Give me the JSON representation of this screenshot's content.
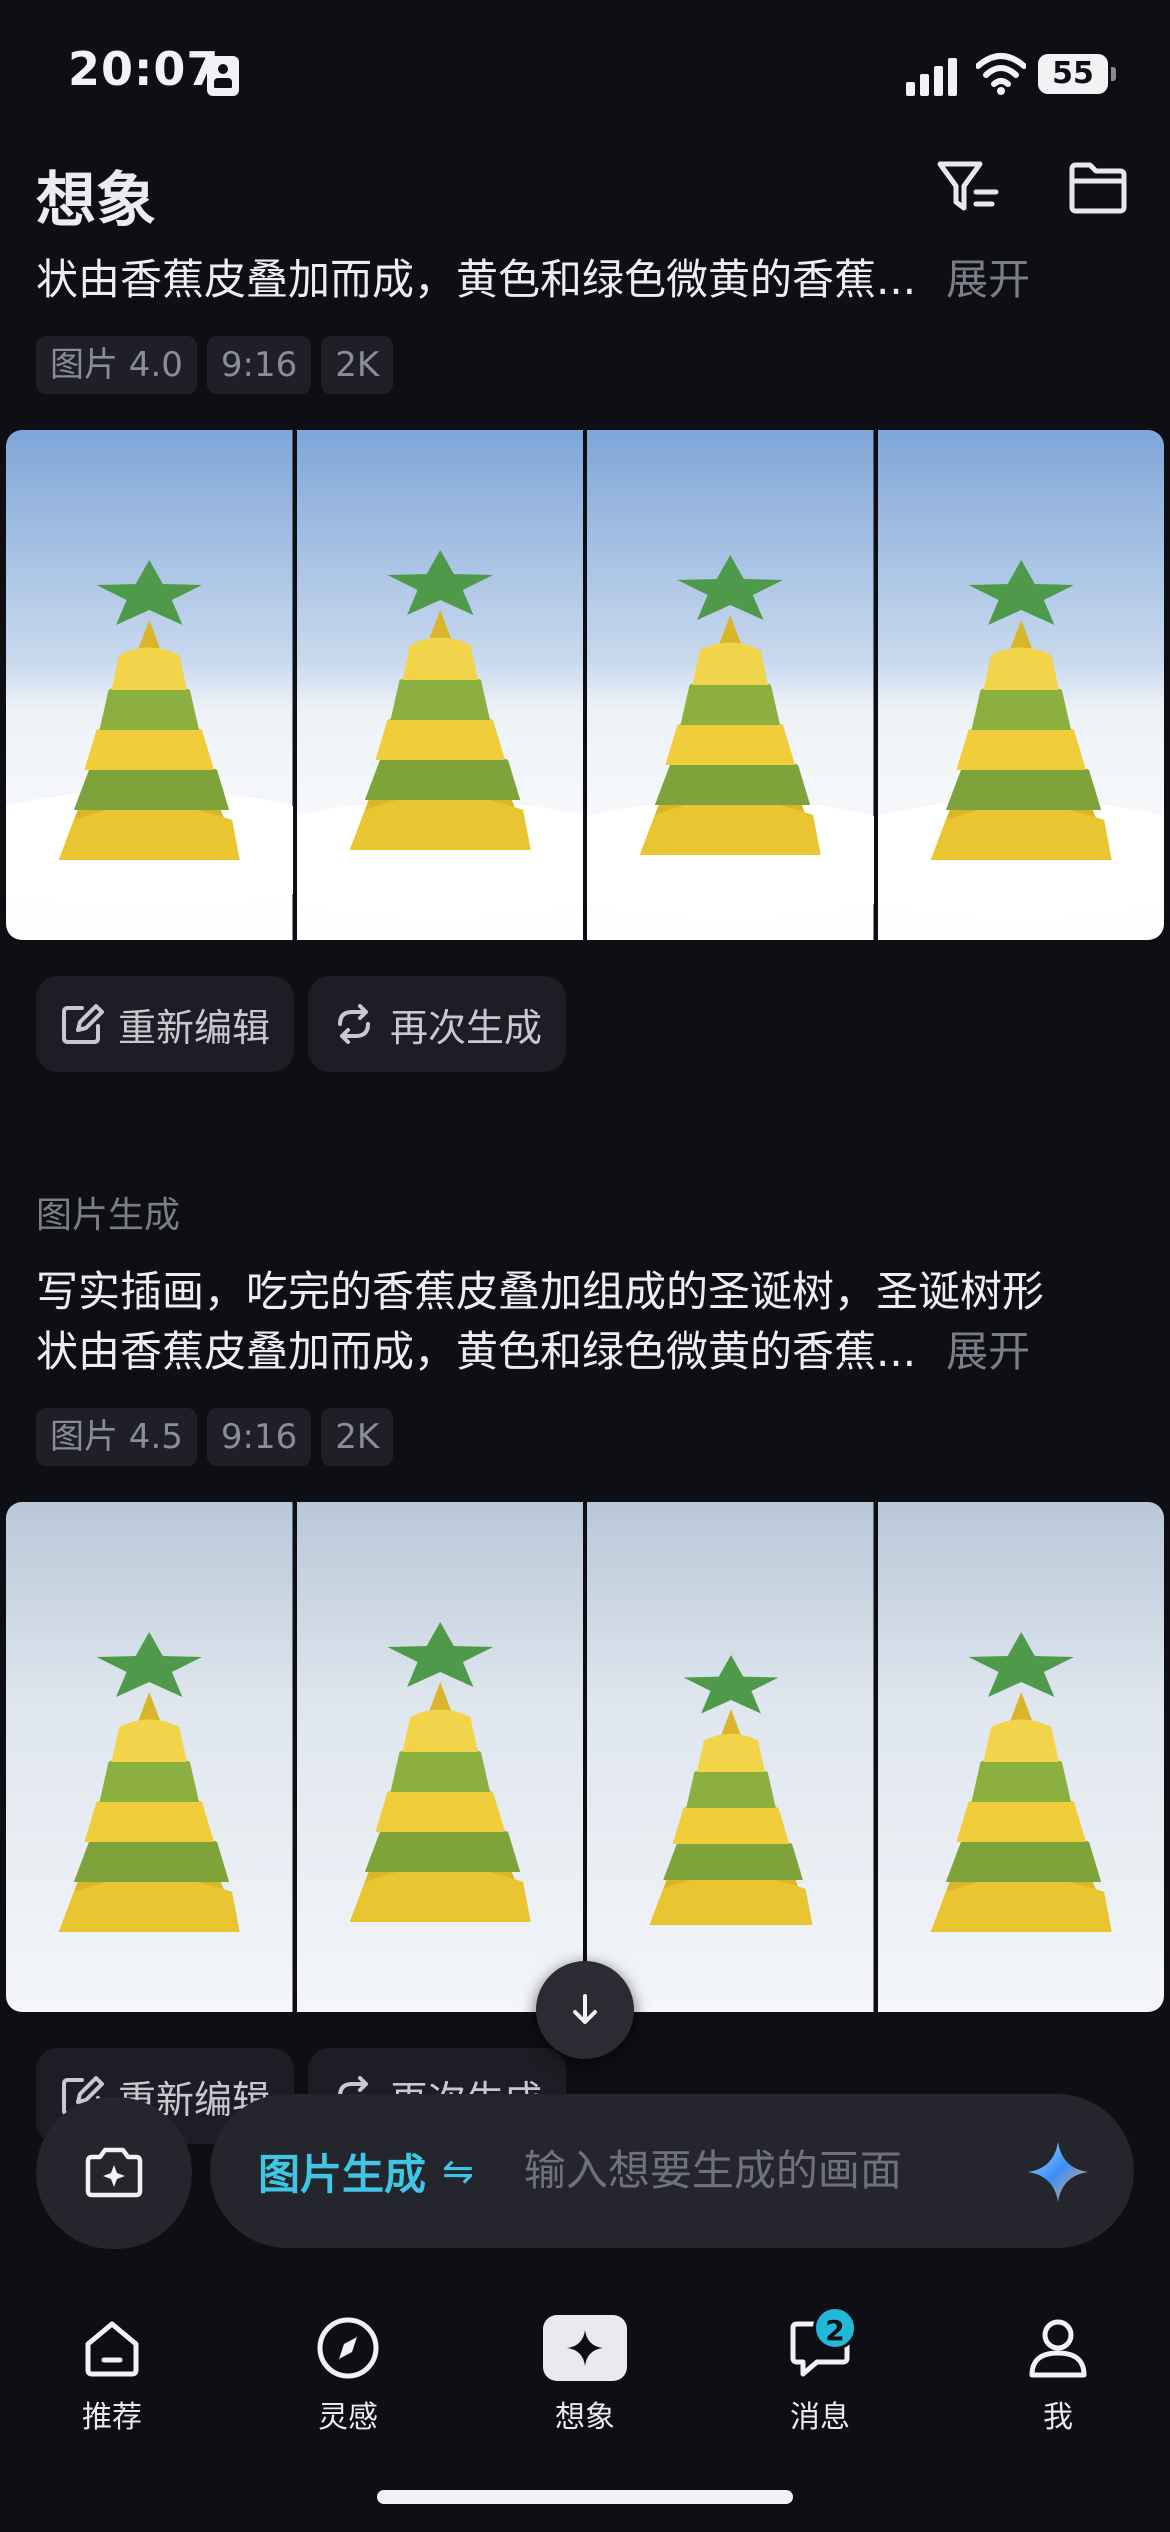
{
  "status_bar": {
    "time": "20:07",
    "battery": "55"
  },
  "header": {
    "title": "想象"
  },
  "block1": {
    "prompt_line2": "状由香蕉皮叠加而成，黄色和绿色微黄的香蕉...",
    "expand": "展开",
    "chips": [
      "图片 4.0",
      "9:16",
      "2K"
    ],
    "actions": {
      "re_edit": "重新编辑",
      "regenerate": "再次生成"
    }
  },
  "block2": {
    "label": "图片生成",
    "prompt_line1": "写实插画，吃完的香蕉皮叠加组成的圣诞树，圣诞树形",
    "prompt_line2": "状由香蕉皮叠加而成，黄色和绿色微黄的香蕉...",
    "expand": "展开",
    "chips": [
      "图片 4.5",
      "9:16",
      "2K"
    ],
    "actions": {
      "re_edit": "重新编辑",
      "regenerate": "再次生成"
    }
  },
  "composer": {
    "mode": "图片生成",
    "mode_swap": "⇋",
    "placeholder": "输入想要生成的画面"
  },
  "nav": {
    "items": [
      {
        "label": "推荐",
        "icon": "home-icon"
      },
      {
        "label": "灵感",
        "icon": "compass-icon"
      },
      {
        "label": "想象",
        "icon": "sparkle-icon"
      },
      {
        "label": "消息",
        "icon": "chat-icon",
        "badge": "2"
      },
      {
        "label": "我",
        "icon": "profile-icon"
      }
    ]
  },
  "colors": {
    "accent": "#3ec6e4",
    "background": "#0e0f14",
    "chip_bg": "#1f2027"
  }
}
